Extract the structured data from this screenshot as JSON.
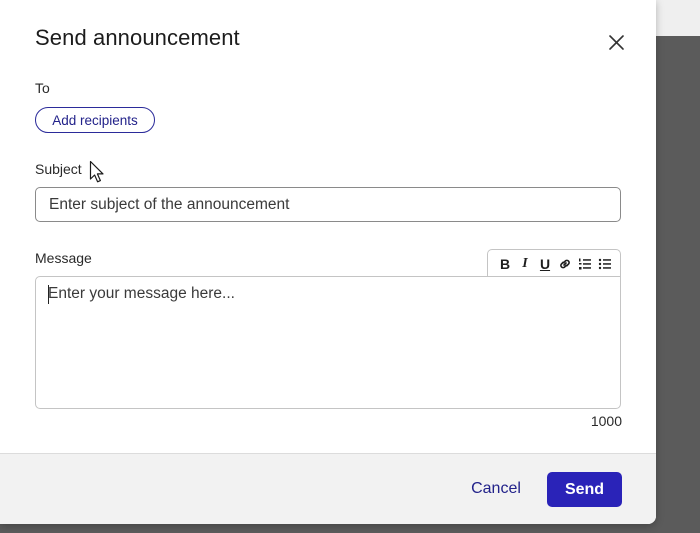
{
  "dialog": {
    "title": "Send announcement",
    "close_icon": "close-icon"
  },
  "recipients": {
    "label": "To",
    "add_button_label": "Add recipients"
  },
  "subject": {
    "label": "Subject",
    "value": "",
    "placeholder": "Enter subject of the announcement"
  },
  "message": {
    "label": "Message",
    "value": "",
    "placeholder": "Enter your message here...",
    "char_count": "1000",
    "toolbar": {
      "bold_glyph": "B",
      "italic_glyph": "I",
      "underline_glyph": "U",
      "icons": [
        "bold-icon",
        "italic-icon",
        "underline-icon",
        "link-icon",
        "numbered-list-icon",
        "bullet-list-icon"
      ]
    }
  },
  "footer": {
    "cancel_label": "Cancel",
    "send_label": "Send"
  },
  "colors": {
    "accent": "#2a23b8",
    "link_text": "#22228a",
    "overlay": "#5b5b5b",
    "footer_bg": "#f2f2f2"
  }
}
